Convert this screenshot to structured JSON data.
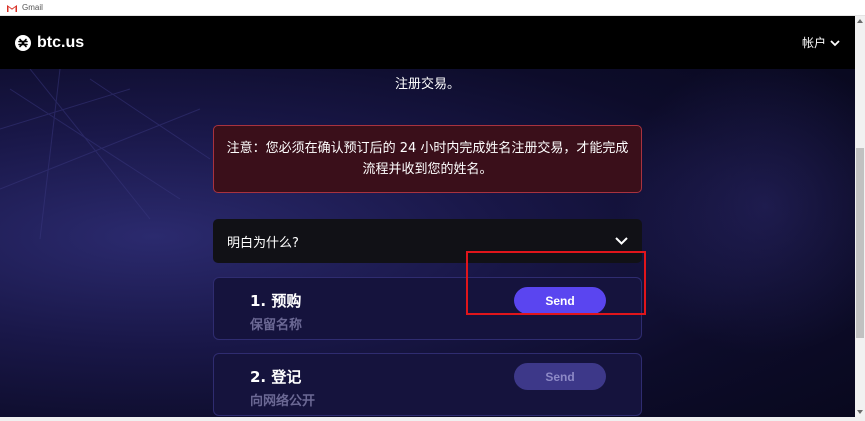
{
  "browser": {
    "tab_title": "Gmail",
    "tab_icon": "gmail-icon"
  },
  "header": {
    "logo_text": "btc.us",
    "account_label": "帐户",
    "account_icon": "chevron-down-icon"
  },
  "content": {
    "intro_text": "注册交易。",
    "notice": {
      "line1": "注意：您必须在确认预订后的 24 小时内完成姓名注册交易，才能完成",
      "line2": "流程并收到您的姓名。"
    },
    "why_label": "明白为什么?",
    "steps": [
      {
        "title": "1. 预购",
        "subtitle": "保留名称",
        "button_label": "Send",
        "enabled": true
      },
      {
        "title": "2. 登记",
        "subtitle": "向网络公开",
        "button_label": "Send",
        "enabled": false
      }
    ]
  },
  "colors": {
    "accent": "#5a45f0",
    "disabled_button": "#3d3889",
    "notice_background": "#3a0f1a",
    "notice_border": "#a8323f",
    "highlight": "#e0151b",
    "header_background": "#000000"
  }
}
